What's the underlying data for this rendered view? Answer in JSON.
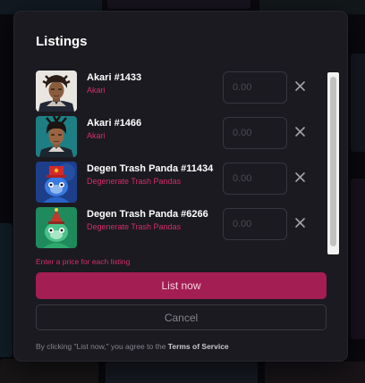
{
  "modal": {
    "title": "Listings",
    "error_message": "Enter a price for each listing",
    "primary_button": "List now",
    "secondary_button": "Cancel",
    "legal_prefix": "By clicking \"List now,\" you agree to the ",
    "legal_link": "Terms of Service"
  },
  "listings": [
    {
      "name": "Akari #1433",
      "collection": "Akari",
      "price_placeholder": "0.00"
    },
    {
      "name": "Akari #1466",
      "collection": "Akari",
      "price_placeholder": "0.00"
    },
    {
      "name": "Degen Trash Panda #11434",
      "collection": "Degenerate Trash Pandas",
      "price_placeholder": "0.00"
    },
    {
      "name": "Degen Trash Panda #6266",
      "collection": "Degenerate Trash Pandas",
      "price_placeholder": "0.00"
    }
  ],
  "colors": {
    "accent": "#a31e52",
    "accent_text": "#d32e6c",
    "modal_background": "#1b1a20",
    "page_background": "#0c0c10"
  },
  "icons": {
    "remove": "close-icon"
  }
}
